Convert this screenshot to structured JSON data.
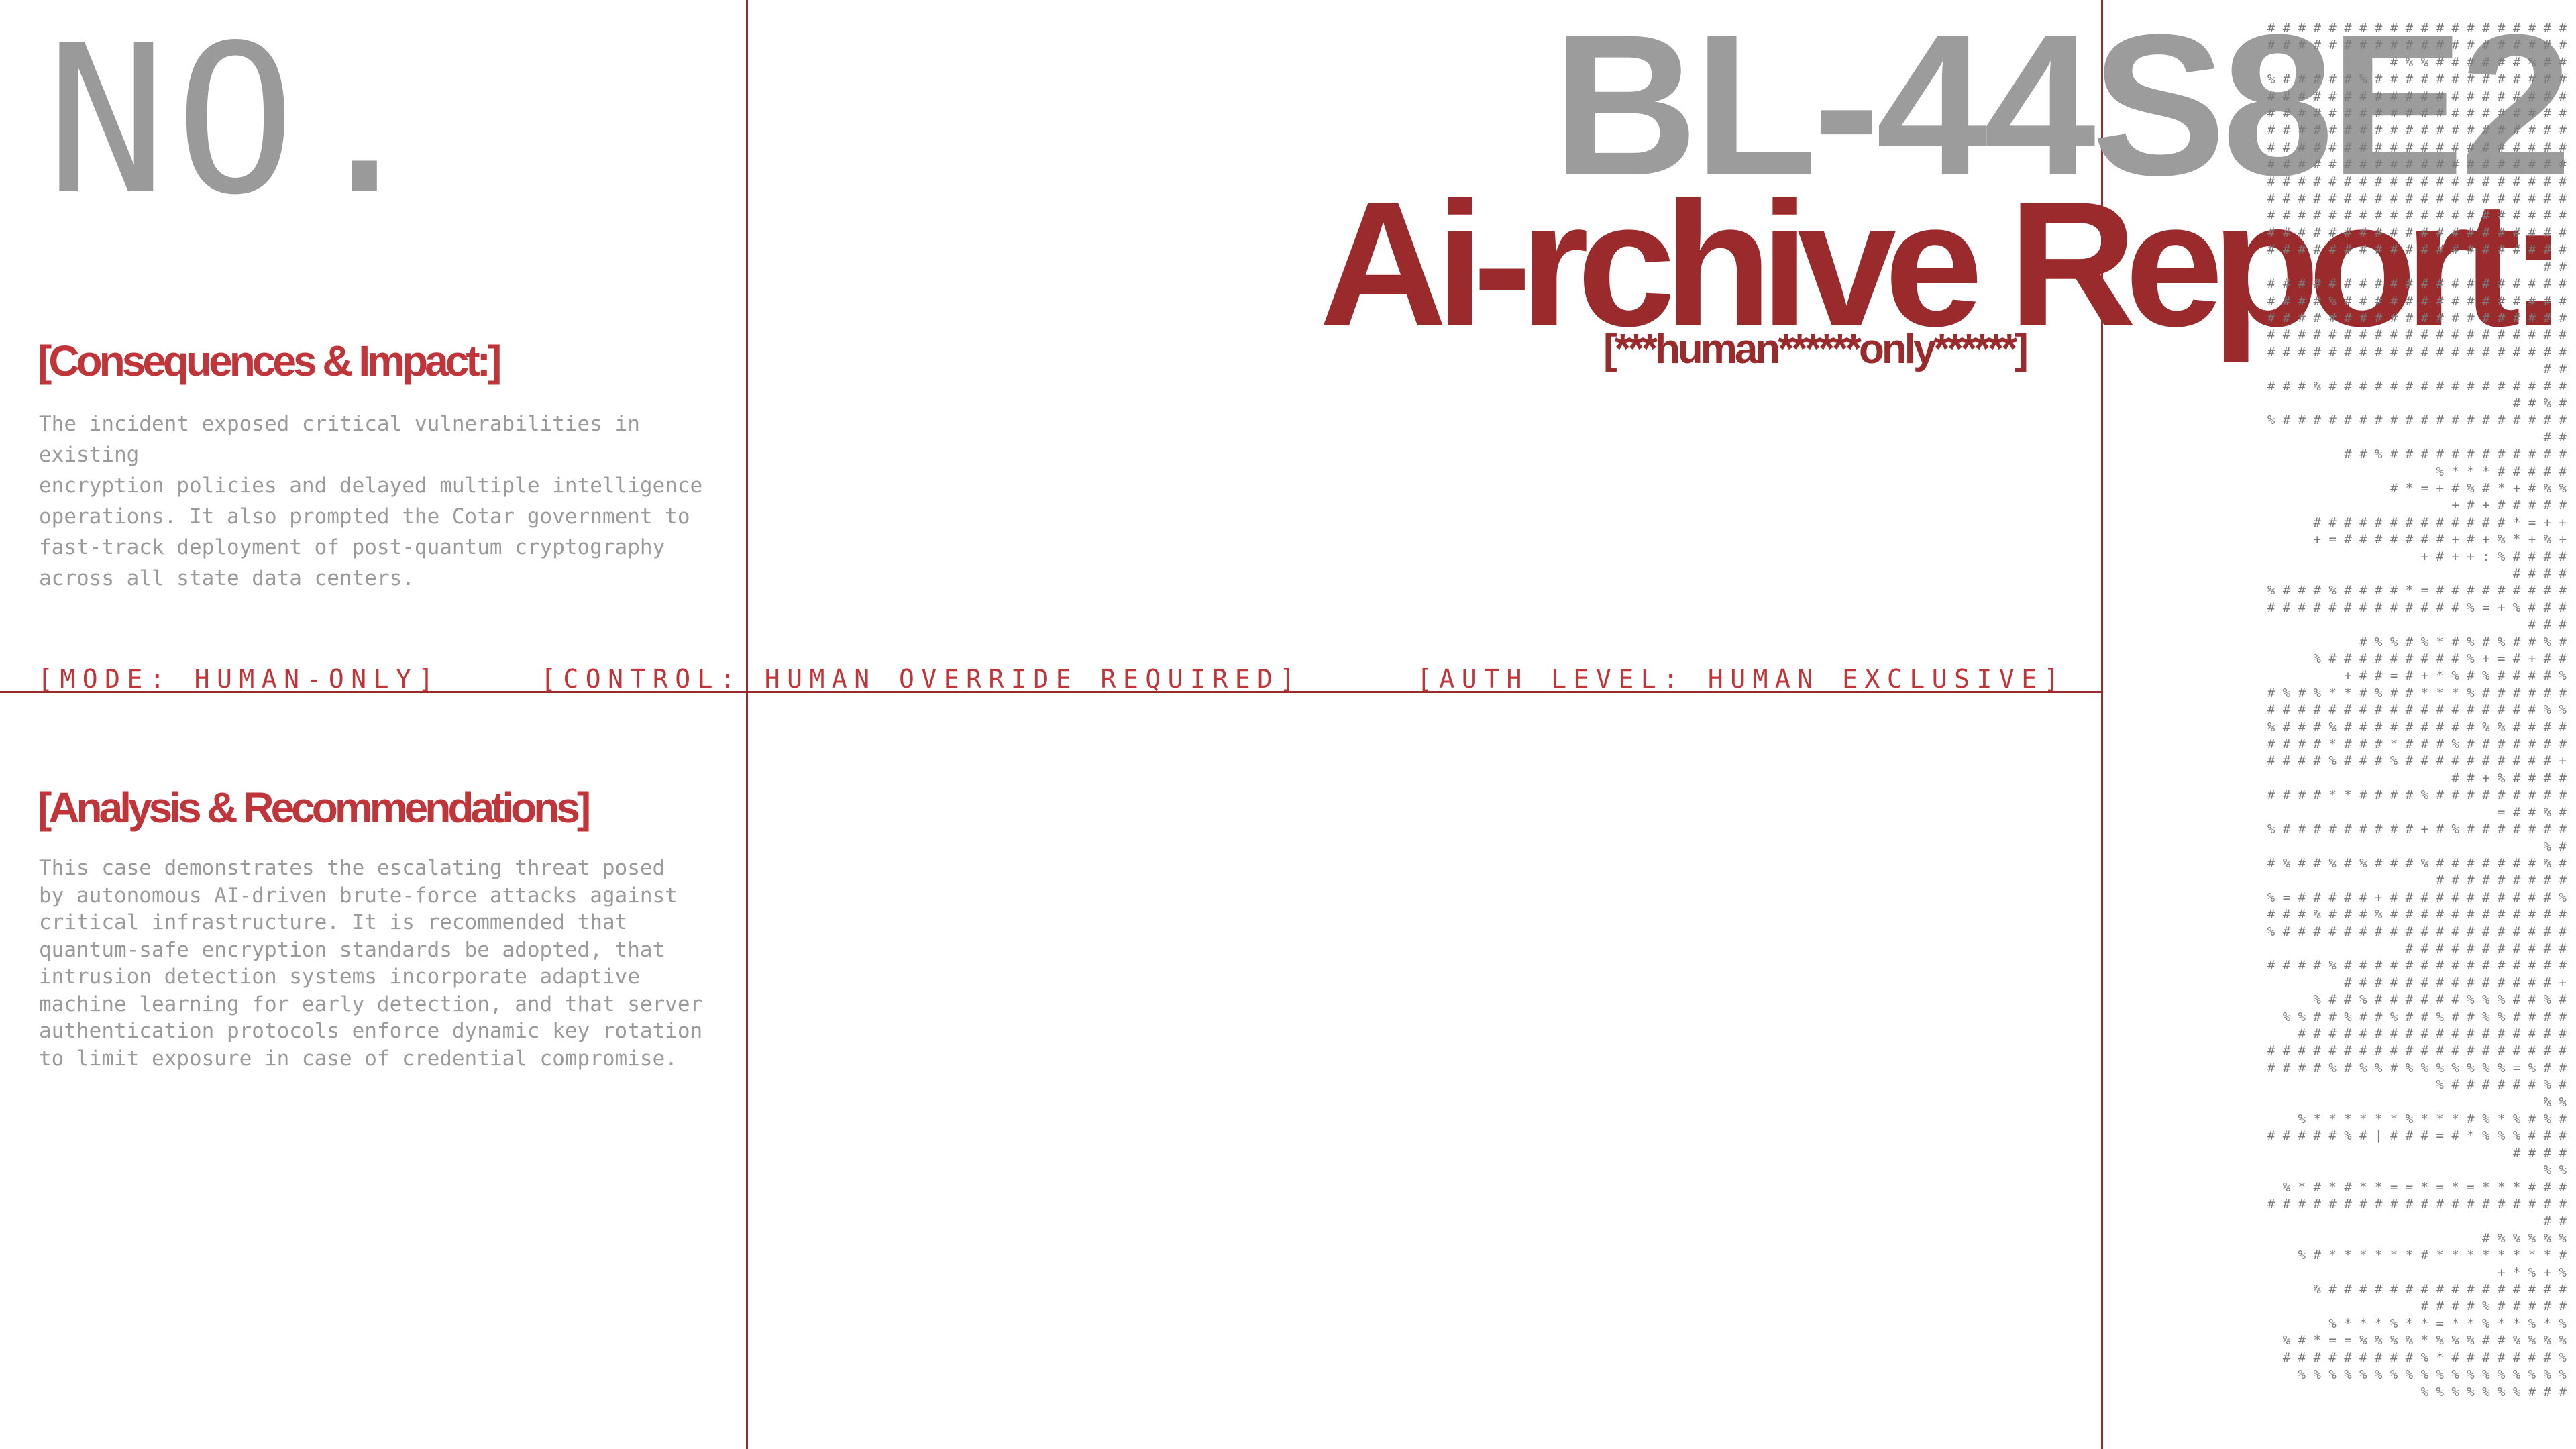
{
  "header": {
    "no_label": "NO.",
    "report_id": "BL-44S8E2",
    "report_title": "Ai-rchive Report:",
    "report_tag": "[***human******only******]"
  },
  "sections": [
    {
      "heading": "[Consequences & Impact:]",
      "body": "The incident exposed critical vulnerabilities in existing\nencryption policies and delayed multiple intelligence\noperations. It also prompted the Cotar government to\nfast-track deployment of post-quantum cryptography\nacross all state data centers."
    },
    {
      "heading": "[Analysis & Recommendations]",
      "body": "This case demonstrates the escalating threat posed\nby autonomous AI-driven brute-force attacks against\ncritical infrastructure. It is recommended that\nquantum-safe encryption standards be adopted, that\nintrusion detection systems incorporate adaptive\nmachine learning for early detection, and that server\nauthentication protocols enforce dynamic key rotation\nto limit exposure in case of credential compromise."
    }
  ],
  "status_bar": [
    "[MODE: HUMAN-ONLY]",
    "[CONTROL: HUMAN OVERRIDE REQUIRED]",
    "[AUTH LEVEL: HUMAN EXCLUSIVE]"
  ],
  "ascii_art": [
    "# # # # # # # # # # # # # # # # # # # #",
    "# # # # # # # # # # # # # # # # # # # #",
    "# % % # # # # # # % # #",
    "% # # # # # % # # # # # # # # # # # # #",
    "# # # # # # # # # # # # # # # # # # # #",
    "# # # # # # # # # # # # # # # # # # # #",
    "# # # # # # # # # # # # # # # # # # # #",
    "# # # # # # # # # # # # # # # # # # # #",
    "# # # # # # # # # # # # # # # # # # # #",
    "# # # # # # # # # # # # # # # # # # # #",
    "# # # # # # # # # # # # # # # # # # # #",
    "# # # # # # # # # # # # # # # # # # # #",
    "# # # # # # # # # # # # # # # # # # # #",
    "# # # # # # # # # # # # # # # # # # # #",
    "# #",
    "# # # # # # # # # # # # # # # # # # # #",
    "# # # # % # # # # # # # # # # # # # # #",
    "# # # # # # # # # # # # # # # # # # # #",
    "# # # # # # # # # # # # # # # # # # # #",
    "# # # # # # # # # # # # # # # # # # # #",
    "# #",
    "# # # % # # # # # # # # # # # # # # # #",
    "# # % #",
    "% # # # # # # # # # # # # # # # # # # #",
    "# #",
    "# # % # # # # # # # # # # # #",
    "% * * * # # # # #",
    "# * = + # % # * + # % %",
    "+ # + # # # # #",
    "# # # # # # # # # # # # # * = + +",
    "+ = # # # # # # # + # + % * + % +",
    "+ # + + : % # # # #",
    "# # # #",
    "% # # # % # # # # * = # # # # # # # # #",
    "# # # # # # # # # # # # # % = + % # # #",
    "# # #",
    "# % % # % * # % # % # # % #",
    "% # # # # # # # # # % + = # + # #",
    "+ # # = # + * % # % # # # # %",
    "# % # % * * # % # # * * * % # # # # # #",
    "# # # # # # # # # # # # # # # # # # % %",
    "% # # # % # # # # # # # # # % % # # # #",
    "# # # # * # # # * # # # % # # # # # # #",
    "# # # # % # # # % # # # # # # # # # # +",
    "# # + % # # # #",
    "# # # # * * # # # # % # # # # # # # # #",
    "= # # % #",
    "% # # # # # # # # # + # % # # # # # # #",
    "% #",
    "# % # # % # % # # # % # # # # # # # % #",
    "# # # # # # # # #",
    "% = # # # # # + # # # # # # # # # # # %",
    "# # # % # # # % # # # # # # # # # # # #",
    "% # # # # # # # # # # # # # # # # # # #",
    "# # # # # # # # # # #",
    "# # # # % # # # # # # # # # # # # # # #",
    "# # # # # # # # # # # # # # +",
    "% # # % # # # # # # % % % # # % #",
    "% % # # % # # % # # % # # % % # # # #",
    "# # # # # # # # # # # # # # # # # #",
    "# # # # # # # # # # # # # # # # # # # #",
    "# # # # % # % % # % % % % % % % = % # #",
    "% # # # # # # % #",
    "% %",
    "% * * * * * * % * * * # % * % # % #",
    "# # # # # % # | # # # = # * % % % # # #",
    "# # # #",
    "% %",
    "% * # * # * * = = * = * = * * * # # #",
    "# # # # # # # # # # # # # # # # # # # #",
    "# #",
    "# % % % % %",
    "% # * * * * * * # * * * * * * * * #",
    "+ * % + %",
    "% # # # # # # # # # # # # # # # #",
    "# # # # % # # # # #",
    "% * * * % * * = * * % * * % * %",
    "% # * = = % % % % * % % % # # % % % %",
    "# # # # # # # # # % * # # # # # # # %",
    "% % % % % % % % % % % % % % % % % %",
    "% % % % % % % # # #"
  ]
}
